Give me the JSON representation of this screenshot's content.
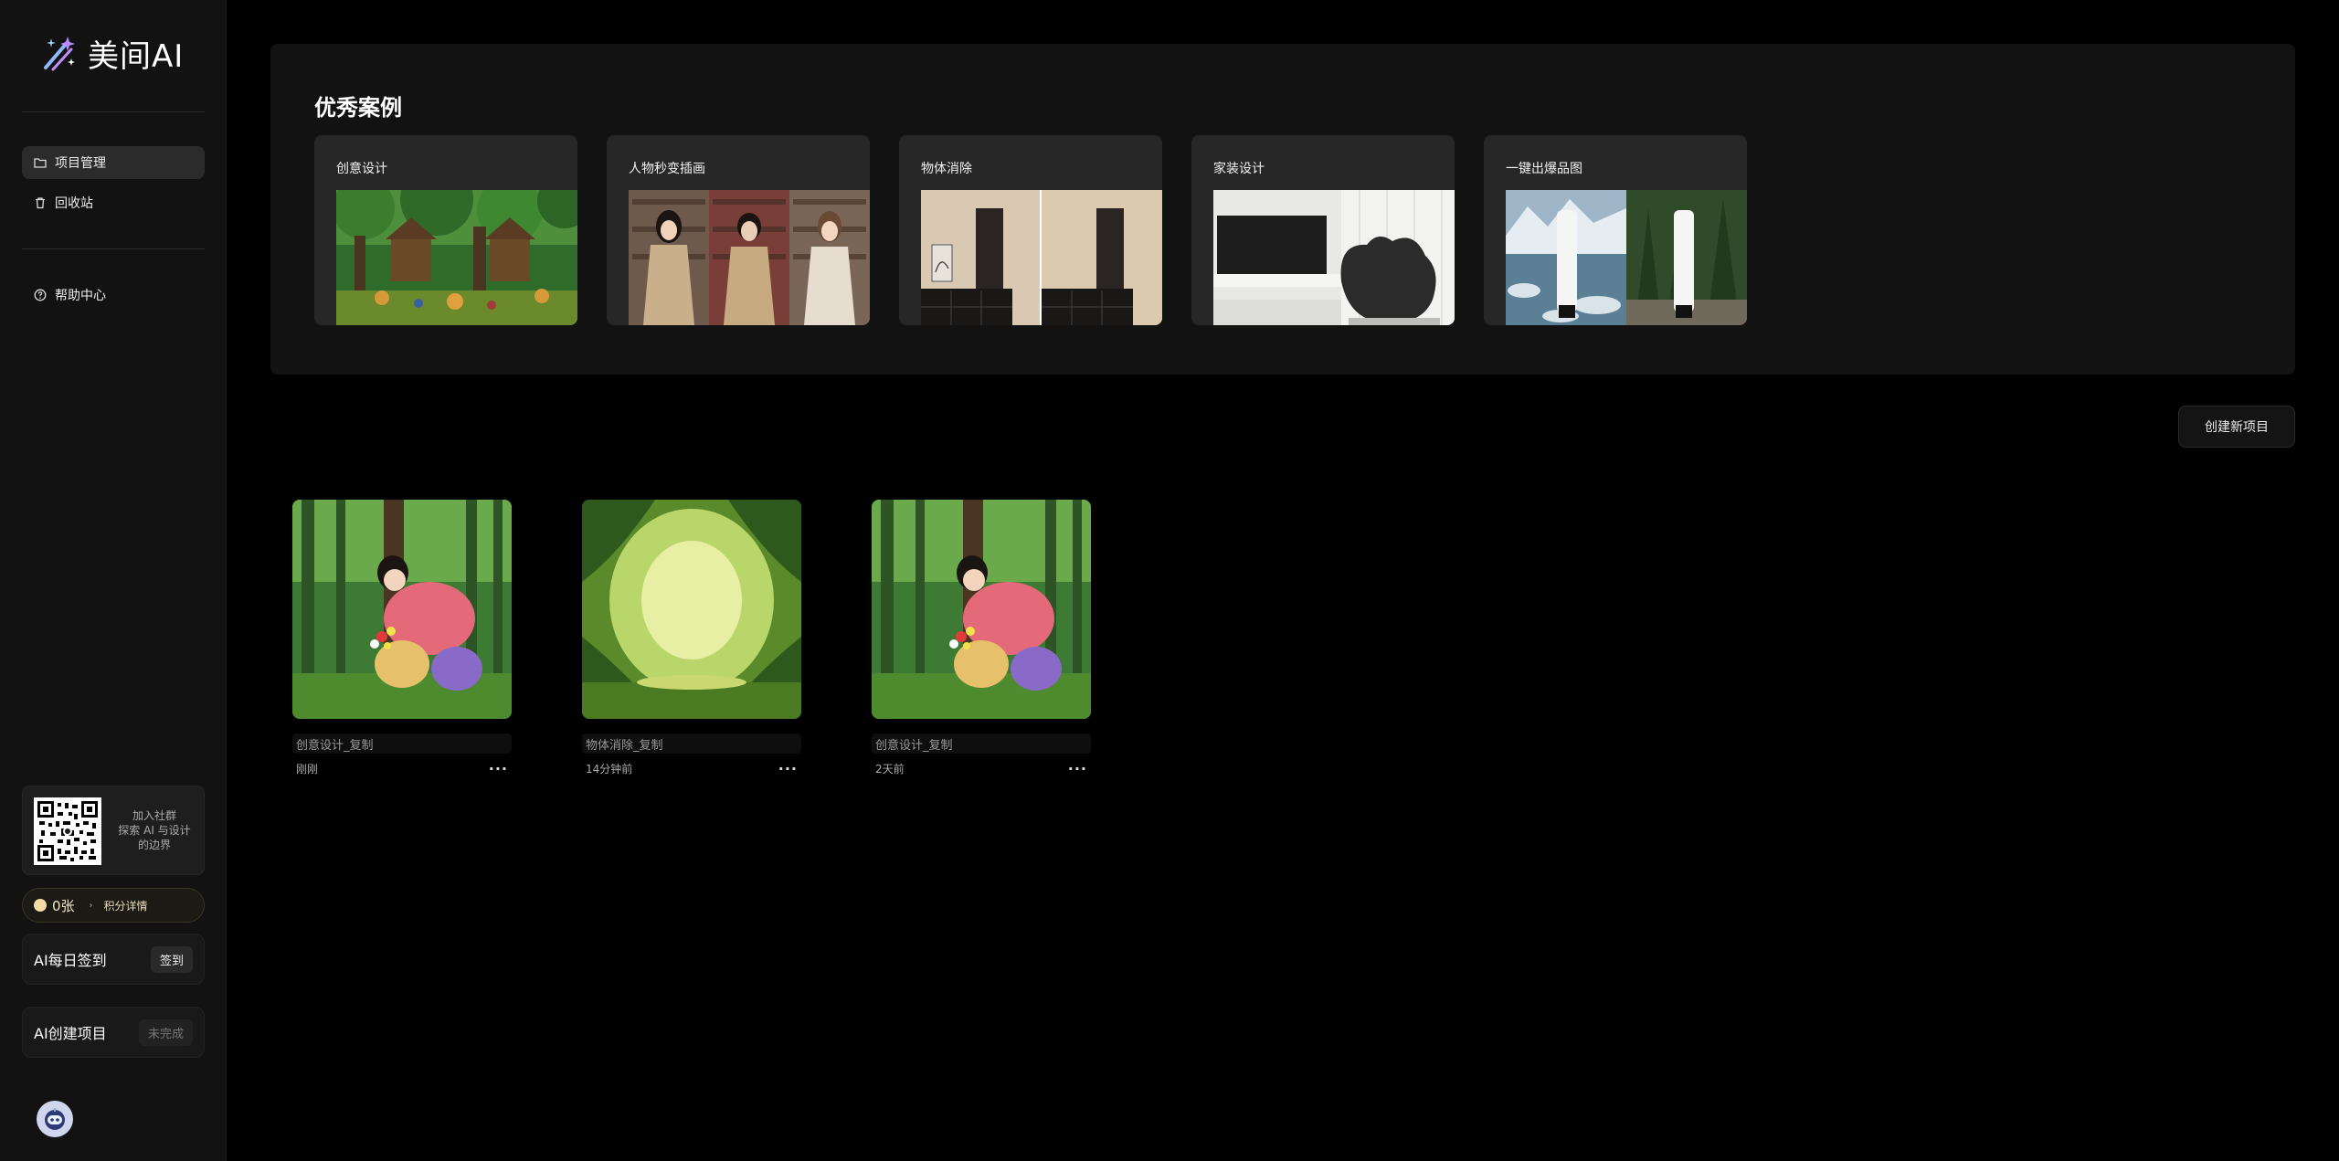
{
  "brand": {
    "name": "美间AI"
  },
  "sidebar": {
    "items": [
      {
        "label": "项目管理",
        "icon": "folder-icon",
        "active": true
      },
      {
        "label": "回收站",
        "icon": "trash-icon",
        "active": false
      }
    ],
    "help": {
      "label": "帮助中心",
      "icon": "help-circle-icon"
    },
    "community": {
      "line1": "加入社群",
      "line2": "探索 AI 与设计",
      "line3": "的边界"
    },
    "points": {
      "value": "0张",
      "detail": "积分详情"
    },
    "tasks": [
      {
        "title": "AI每日签到",
        "button": "签到"
      },
      {
        "title": "AI创建项目",
        "button": "未完成"
      }
    ]
  },
  "showcase": {
    "title": "优秀案例",
    "cases": [
      {
        "label": "创意设计"
      },
      {
        "label": "人物秒变插画"
      },
      {
        "label": "物体消除"
      },
      {
        "label": "家装设计"
      },
      {
        "label": "一键出爆品图"
      }
    ]
  },
  "toolbar": {
    "create_label": "创建新项目"
  },
  "projects": [
    {
      "name": "创意设计_复制",
      "time": "刚刚"
    },
    {
      "name": "物体消除_复制",
      "time": "14分钟前"
    },
    {
      "name": "创意设计_复制",
      "time": "2天前"
    }
  ],
  "colors": {
    "accent_gold": "#f4dba6",
    "background": "#000000",
    "sidebar": "#121212"
  }
}
